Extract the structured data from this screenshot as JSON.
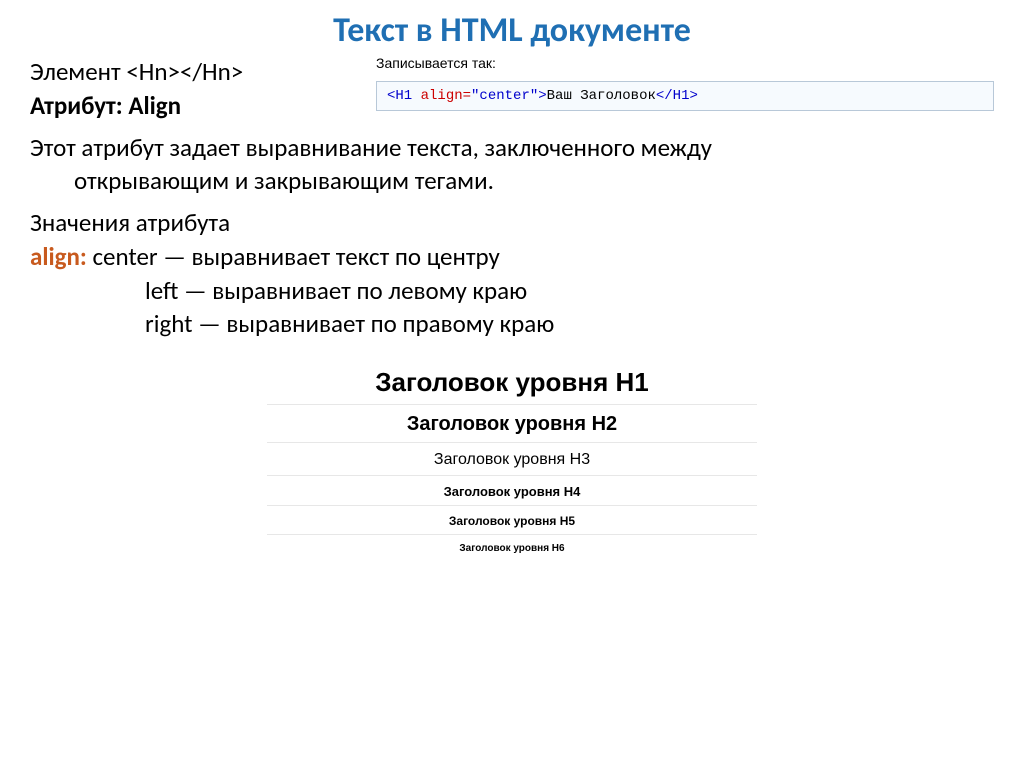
{
  "title": "Текст в HTML документе",
  "element_line_prefix": "Элемент ",
  "element_tag": "<Hn></Hn>",
  "attr_line": "Атрибут: Align",
  "code_caption": "Записывается так:",
  "code": {
    "open": "<H1 ",
    "attr": "align=",
    "val": "\"center\"",
    "close_open": ">",
    "content": "Ваш Заголовок",
    "close": "</H1>"
  },
  "desc_main": "Этот атрибут задает выравнивание текста, заключенного между",
  "desc_cont": "открывающим и закрывающим тегами.",
  "values_title": "Значения атрибута",
  "align_label": "align:",
  "val1": "   center — выравнивает текст по центру",
  "val2": "left —    выравнивает по левому краю",
  "val3": "right — выравнивает по правому краю",
  "samples": {
    "h1": "Заголовок уровня H1",
    "h2": "Заголовок уровня H2",
    "h3": "Заголовок уровня H3",
    "h4": "Заголовок уровня H4",
    "h5": "Заголовок уровня H5",
    "h6": "Заголовок уровня H6"
  }
}
